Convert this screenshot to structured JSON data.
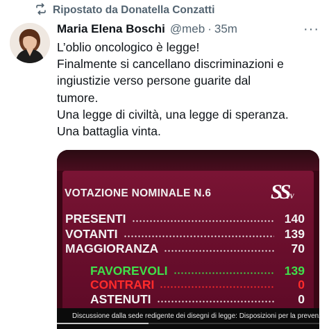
{
  "repost": {
    "icon": "repost-icon",
    "label": "Ripostato da Donatella Conzatti"
  },
  "post": {
    "author_name": "Maria Elena Boschi",
    "handle": "@meb",
    "separator": "·",
    "time": "35m",
    "more_icon": "more-icon",
    "more_glyph": "···",
    "lines": [
      "L’oblio oncologico è legge!",
      "Finalmente si cancellano discriminazioni e",
      "ingiustizie verso persone guarite dal",
      "tumore.",
      "Una legge di civiltà, una legge di speranza.",
      "Una battaglia vinta."
    ]
  },
  "media": {
    "board_title": "VOTAZIONE NOMINALE N.6",
    "logo": "SS",
    "logo_sub": "TV",
    "rows": [
      {
        "label": "PRESENTI",
        "value": "140"
      },
      {
        "label": "VOTANTI",
        "value": "139"
      },
      {
        "label": "MAGGIORANZA",
        "value": "70"
      }
    ],
    "votes": [
      {
        "label": "FAVOREVOLI",
        "value": "139",
        "color": "#3fe04a"
      },
      {
        "label": "CONTRARI",
        "value": "0",
        "color": "#ff2b2b"
      },
      {
        "label": "ASTENUTI",
        "value": "0",
        "color": "#f3f3f3"
      }
    ],
    "ticker": "Discussione dalla sede redigente dei disegni di legge: Disposizioni per la prevenzione dell"
  }
}
